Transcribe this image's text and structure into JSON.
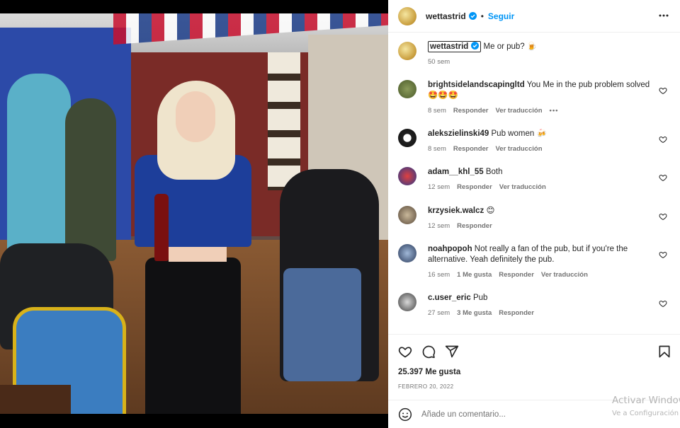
{
  "post": {
    "username": "wettastrid",
    "separator": "•",
    "follow_label": "Seguir",
    "caption_text": "Me or pub? 🍺",
    "caption_time": "50 sem",
    "likes": "25.397 Me gusta",
    "date": "FEBRERO 20, 2022",
    "comment_placeholder": "Añade un comentario...",
    "icons": {
      "verified": "verified-badge-icon",
      "more": "more-options-icon",
      "like": "heart-icon",
      "comment": "comment-icon",
      "share": "paper-plane-icon",
      "save": "bookmark-icon",
      "emoji": "emoji-icon"
    }
  },
  "comments": [
    {
      "username": "brightsidelandscapingltd",
      "text": "You Me in the pub problem solved 🤩🤩🤩",
      "time": "8 sem",
      "reply": "Responder",
      "translate": "Ver traducción",
      "more": "•••"
    },
    {
      "username": "alekszielinski49",
      "text": "Pub women 🍻",
      "time": "8 sem",
      "reply": "Responder",
      "translate": "Ver traducción"
    },
    {
      "username": "adam__khl_55",
      "text": "Both",
      "time": "12 sem",
      "reply": "Responder",
      "translate": "Ver traducción"
    },
    {
      "username": "krzysiek.walcz",
      "text": "😊",
      "time": "12 sem",
      "reply": "Responder"
    },
    {
      "username": "noahpopoh",
      "text": "Not really a fan of the pub, but if you're the alternative. Yeah definitely the pub.",
      "time": "16 sem",
      "likes": "1 Me gusta",
      "reply": "Responder",
      "translate": "Ver traducción"
    },
    {
      "username": "c.user_eric",
      "text": "Pub",
      "time": "27 sem",
      "likes": "3 Me gusta",
      "reply": "Responder"
    }
  ],
  "watermark": {
    "line1": "Activar Windows",
    "line2": "Ve a Configuración"
  },
  "colors": {
    "link_blue": "#0095f6",
    "text": "#262626",
    "muted": "#737373",
    "border": "#efefef"
  }
}
